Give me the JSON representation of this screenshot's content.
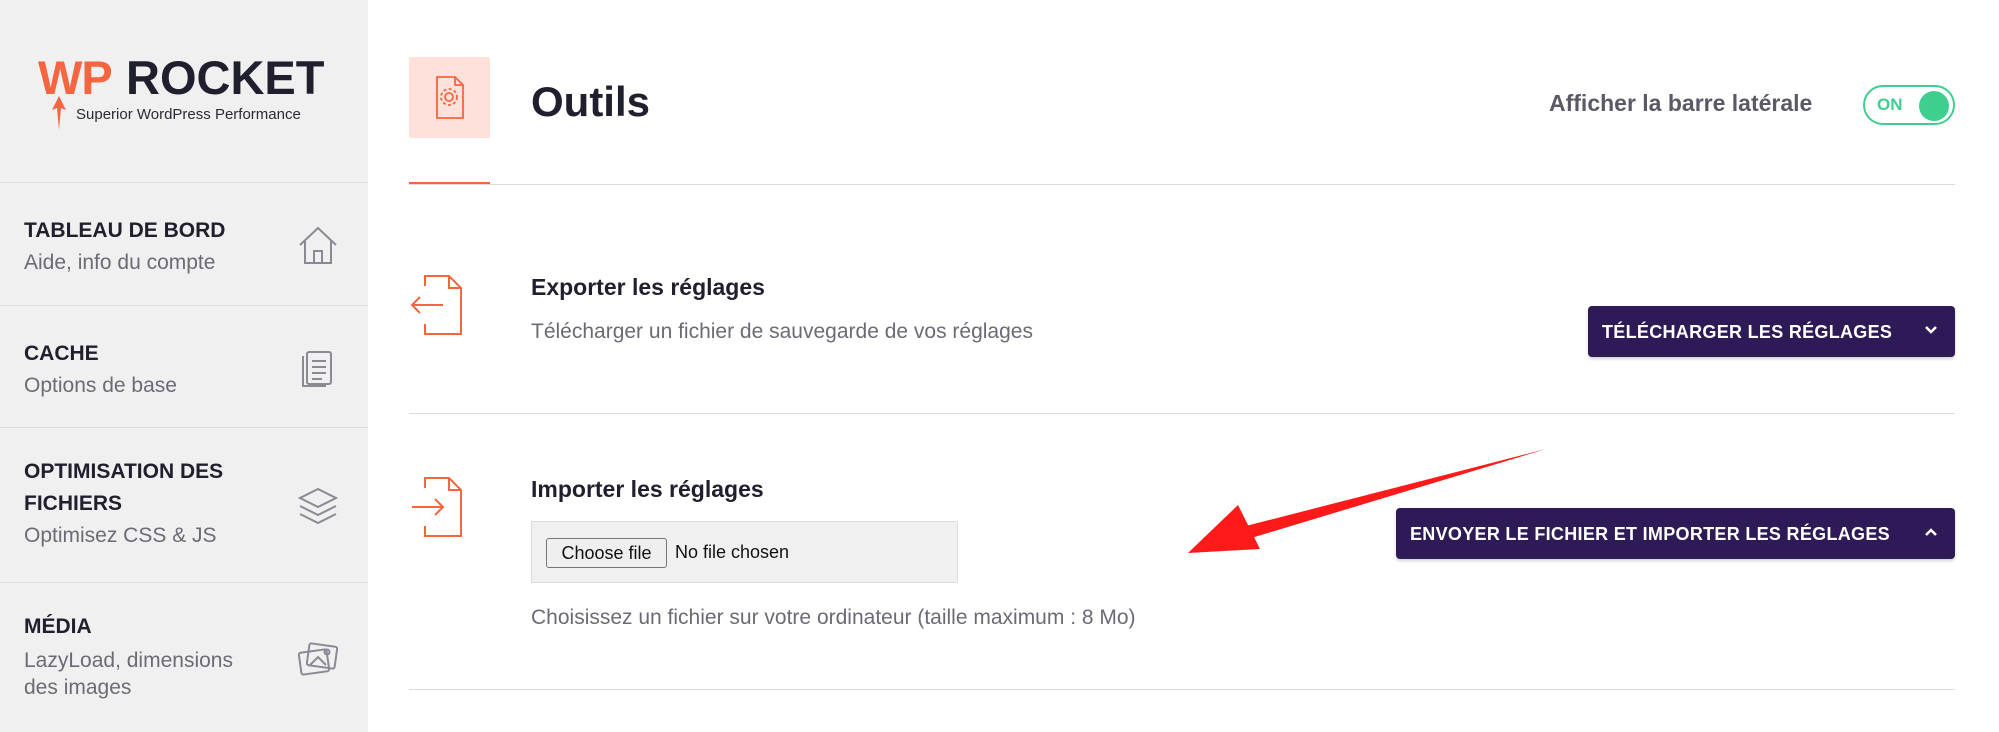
{
  "brand": {
    "wp": "WP",
    "rocket": "ROCKET",
    "tagline": "Superior WordPress Performance",
    "accent": "#f56640",
    "dark": "#1f1f2e"
  },
  "sidebar": {
    "items": [
      {
        "title": "TABLEAU DE BORD",
        "subtitle": "Aide, info du compte",
        "icon": "home-icon"
      },
      {
        "title": "CACHE",
        "subtitle": "Options de base",
        "icon": "document-icon"
      },
      {
        "title": "OPTIMISATION DES FICHIERS",
        "subtitle": "Optimisez CSS & JS",
        "icon": "layers-icon"
      },
      {
        "title": "MÉDIA",
        "subtitle": "LazyLoad, dimensions des images",
        "icon": "images-icon"
      }
    ]
  },
  "header": {
    "title": "Outils",
    "page_icon": "gear-file-icon",
    "sidebar_toggle_label": "Afficher la barre latérale",
    "toggle_state": "ON"
  },
  "export": {
    "title": "Exporter les réglages",
    "description": "Télécharger un fichier de sauvegarde de vos réglages",
    "button": "TÉLÉCHARGER LES RÉGLAGES",
    "icon": "export-icon"
  },
  "import": {
    "title": "Importer les réglages",
    "choose_file": "Choose file",
    "no_file": "No file chosen",
    "hint": "Choisissez un fichier sur votre ordinateur (taille maximum : 8 Mo)",
    "button": "ENVOYER LE FICHIER ET IMPORTER LES RÉGLAGES",
    "icon": "import-icon"
  },
  "colors": {
    "button_bg": "#2e1a57",
    "toggle_on": "#3ecf8e",
    "annotation_arrow": "#ff1a1a"
  }
}
